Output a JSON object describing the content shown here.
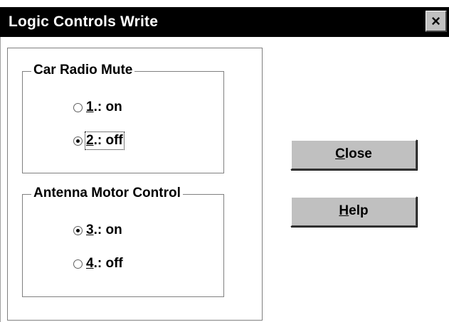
{
  "window": {
    "title": "Logic Controls Write",
    "close_glyph": "×"
  },
  "groups": [
    {
      "title": "Car Radio Mute",
      "options": [
        {
          "mnemonic": "1",
          "suffix": ".:  on",
          "checked": false
        },
        {
          "mnemonic": "2",
          "suffix": ".:  off",
          "checked": true
        }
      ]
    },
    {
      "title": "Antenna Motor Control",
      "options": [
        {
          "mnemonic": "3",
          "suffix": ".:  on",
          "checked": true
        },
        {
          "mnemonic": "4",
          "suffix": ".:  off",
          "checked": false
        }
      ]
    }
  ],
  "buttons": {
    "close": {
      "mnemonic": "C",
      "rest": "lose"
    },
    "help": {
      "mnemonic": "H",
      "rest": "elp"
    }
  },
  "colors": {
    "titlebar": "#000000",
    "button_face": "#c0c0c0",
    "background": "#ffffff"
  },
  "icons": [
    "close-icon",
    "radio-unchecked-icon",
    "radio-checked-icon"
  ]
}
